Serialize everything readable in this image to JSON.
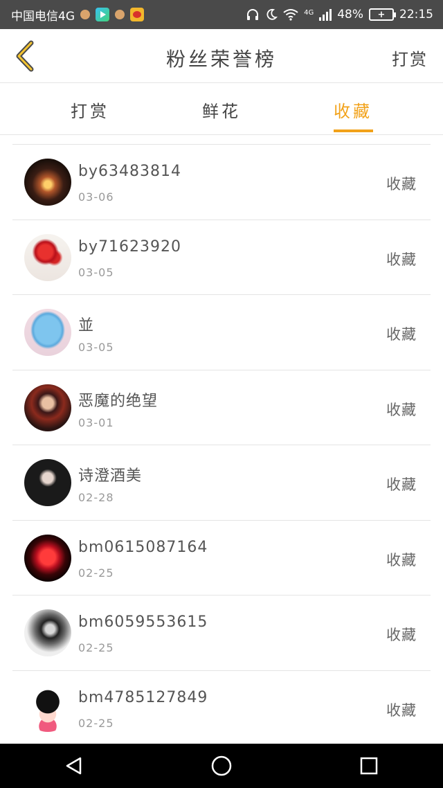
{
  "status_bar": {
    "carrier": "中国电信4G",
    "network": "4G",
    "battery": "48%",
    "time": "22:15"
  },
  "header": {
    "title": "粉丝荣誉榜",
    "right_action": "打赏"
  },
  "tabs": [
    {
      "label": "打赏",
      "active": false
    },
    {
      "label": "鲜花",
      "active": false
    },
    {
      "label": "收藏",
      "active": true
    }
  ],
  "fans": [
    {
      "name": "by63483814",
      "date": "03-06",
      "action": "收藏",
      "avatar": "candle-photo"
    },
    {
      "name": "by71623920",
      "date": "03-05",
      "action": "收藏",
      "avatar": "rose-photo"
    },
    {
      "name": "並",
      "date": "03-05",
      "action": "收藏",
      "avatar": "mooncake-photo"
    },
    {
      "name": "恶魔的绝望",
      "date": "03-01",
      "action": "收藏",
      "avatar": "anime-girl-photo"
    },
    {
      "name": "诗澄酒美",
      "date": "02-28",
      "action": "收藏",
      "avatar": "girl-photo"
    },
    {
      "name": "bm0615087164",
      "date": "02-25",
      "action": "收藏",
      "avatar": "red-rose-photo"
    },
    {
      "name": "bm6059553615",
      "date": "02-25",
      "action": "收藏",
      "avatar": "bw-girl-photo"
    },
    {
      "name": "bm4785127849",
      "date": "02-25",
      "action": "收藏",
      "avatar": "cartoon-girl"
    }
  ],
  "colors": {
    "accent": "#f2a21a",
    "status_bar": "#4a4a4a",
    "text": "#444444",
    "muted": "#999999"
  }
}
